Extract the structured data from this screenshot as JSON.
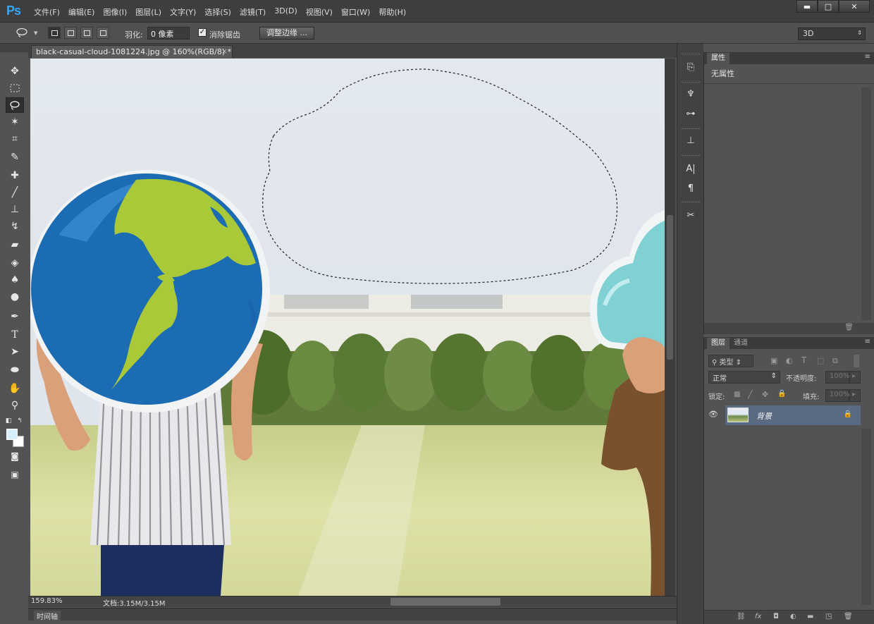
{
  "app": {
    "logo": "Ps"
  },
  "menu": [
    "文件(F)",
    "编辑(E)",
    "图像(I)",
    "图层(L)",
    "文字(Y)",
    "选择(S)",
    "滤镜(T)",
    "3D(D)",
    "视图(V)",
    "窗口(W)",
    "帮助(H)"
  ],
  "window_buttons": {
    "minimize": "▬",
    "maximize": "□",
    "close": "✕"
  },
  "options": {
    "feather_label": "羽化:",
    "feather_value": "0 像素",
    "antialias_label": "消除锯齿",
    "antialias_checked": true,
    "refine_edge_label": "调整边缘 ...",
    "workspace": "3D"
  },
  "document": {
    "tab_title": "black-casual-cloud-1081224.jpg @ 160%(RGB/8) *",
    "close": "×",
    "zoom": "159.83%",
    "doc_size": "文档:3.15M/3.15M"
  },
  "timeline_label": "时间轴",
  "tools": [
    "move-icon",
    "marquee-icon",
    "lasso-icon",
    "magic-wand-icon",
    "crop-icon",
    "eyedropper-icon",
    "healing-icon",
    "brush-icon",
    "clone-stamp-icon",
    "history-brush-icon",
    "eraser-icon",
    "paint-bucket-icon",
    "blur-icon",
    "dodge-icon",
    "pen-icon",
    "type-icon",
    "path-select-icon",
    "ellipse-icon",
    "hand-icon",
    "zoom-icon"
  ],
  "colors": {
    "foreground": "#d5f0fb",
    "background": "#ffffff",
    "accent": "#31a8ff",
    "layer_selected": "#5b6a83"
  },
  "properties_panel": {
    "tab": "属性",
    "content": "无属性"
  },
  "layers_panel": {
    "tabs": [
      "图层",
      "通道"
    ],
    "filter": "类型",
    "blend_mode": "正常",
    "opacity_label": "不透明度:",
    "opacity_value": "100%",
    "lock_label": "锁定:",
    "fill_label": "填充:",
    "fill_value": "100%",
    "layers": [
      {
        "name": "背景",
        "visible": true,
        "locked": true
      }
    ]
  }
}
